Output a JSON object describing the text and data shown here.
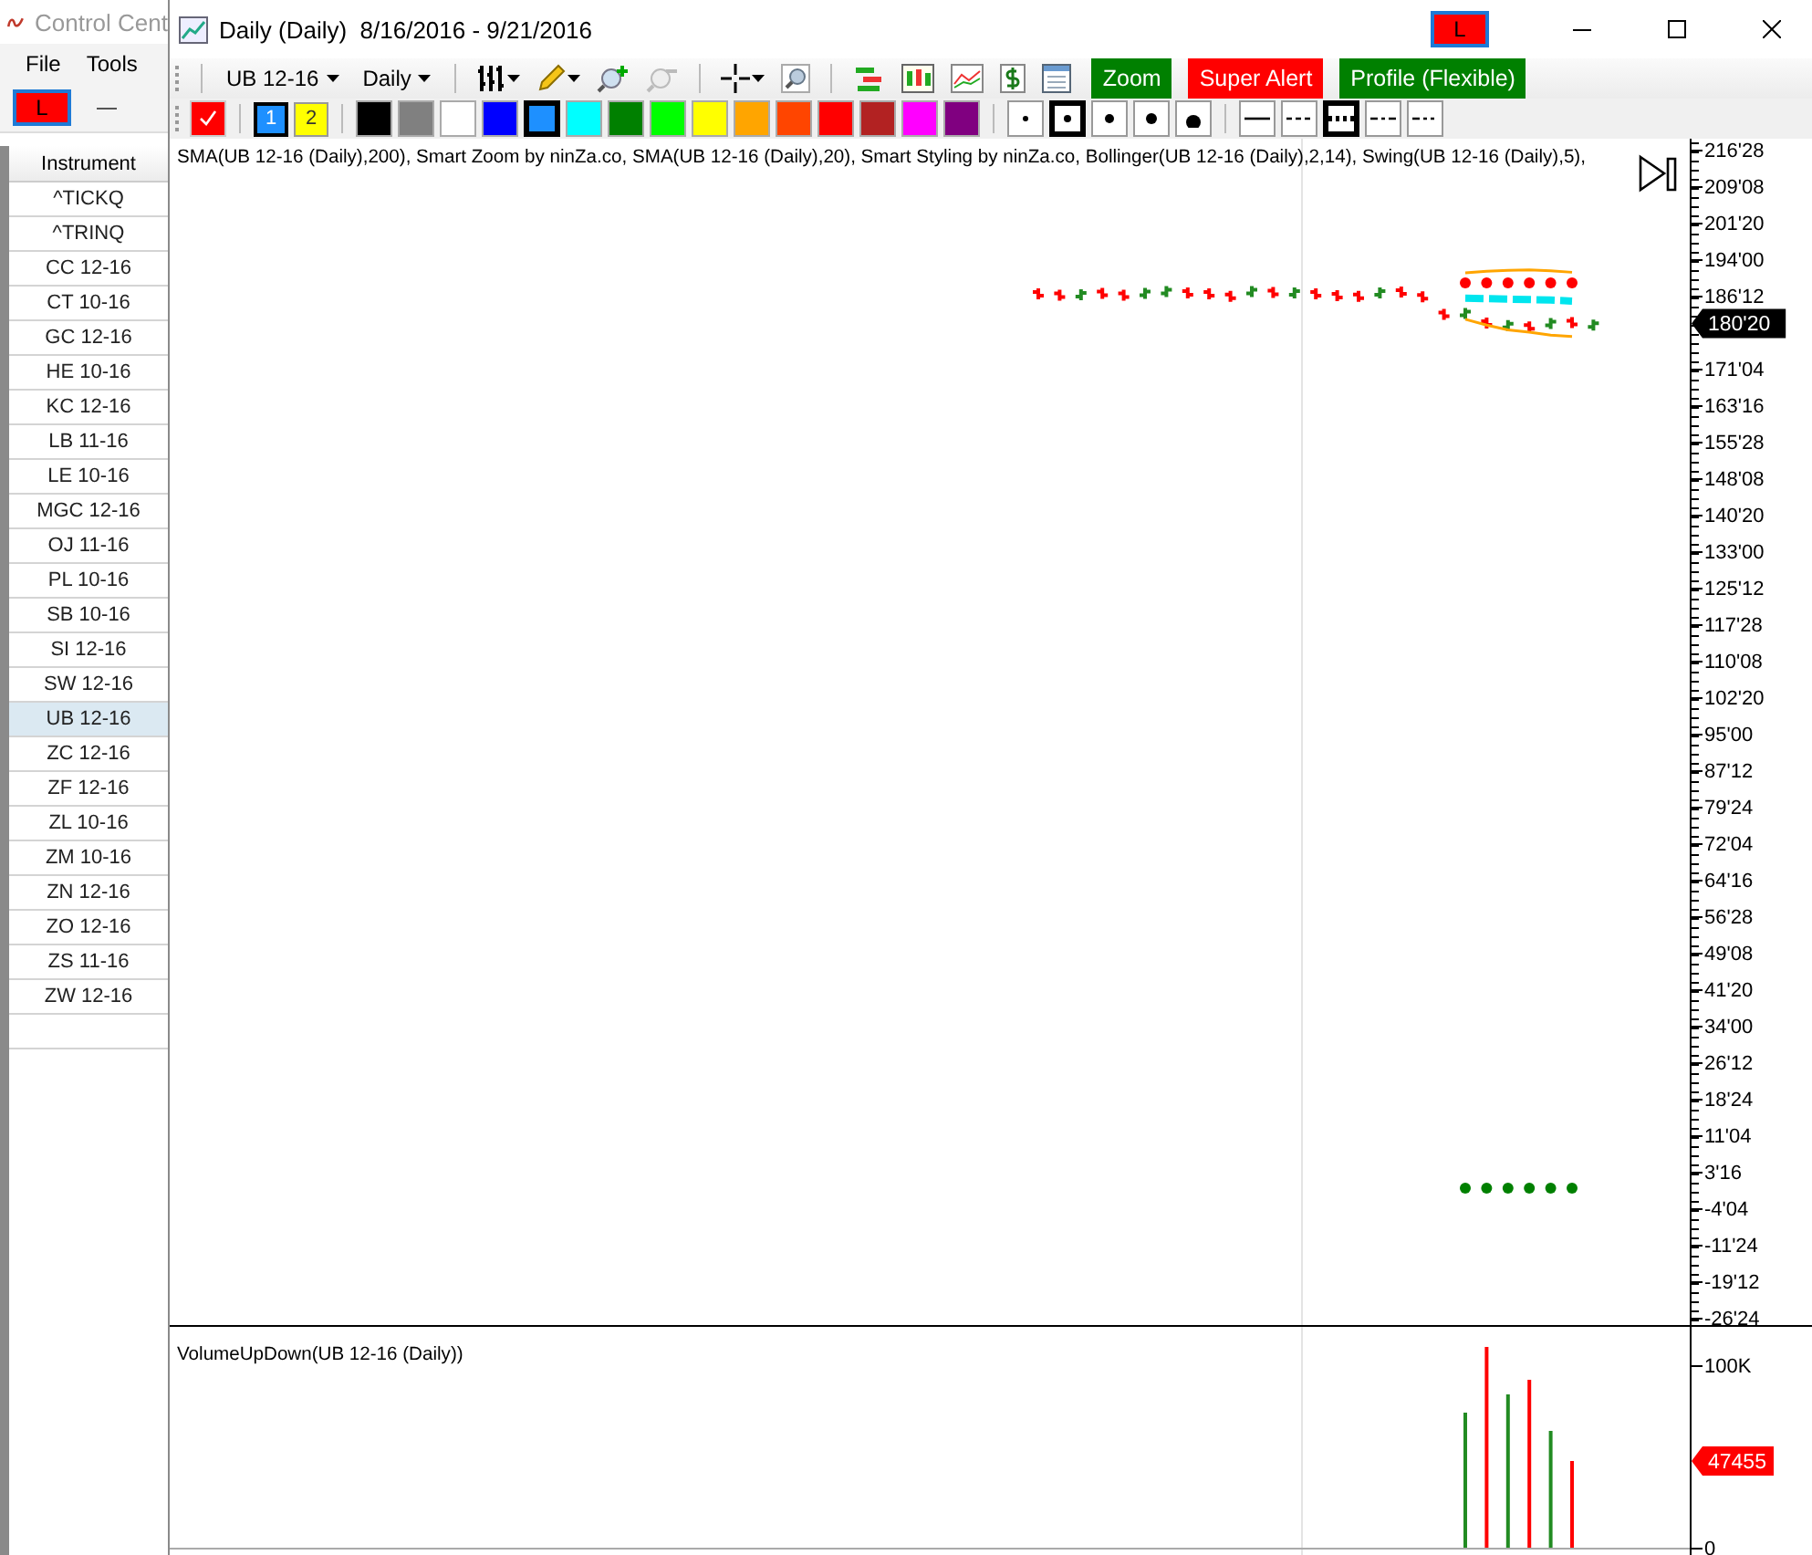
{
  "control_center": {
    "title": "Control Cent",
    "menu": [
      "File",
      "Tools"
    ],
    "link_button": "L",
    "instrument_list": {
      "column": "Instrument",
      "rows": [
        {
          "name": "^TICKQ",
          "selected": false
        },
        {
          "name": "^TRINQ",
          "selected": false
        },
        {
          "name": "CC 12-16",
          "selected": false
        },
        {
          "name": "CT 10-16",
          "selected": false
        },
        {
          "name": "GC 12-16",
          "selected": false
        },
        {
          "name": "HE 10-16",
          "selected": false
        },
        {
          "name": "KC 12-16",
          "selected": false
        },
        {
          "name": "LB 11-16",
          "selected": false
        },
        {
          "name": "LE 10-16",
          "selected": false
        },
        {
          "name": "MGC 12-16",
          "selected": false
        },
        {
          "name": "OJ 11-16",
          "selected": false
        },
        {
          "name": "PL 10-16",
          "selected": false
        },
        {
          "name": "SB 10-16",
          "selected": false
        },
        {
          "name": "SI 12-16",
          "selected": false
        },
        {
          "name": "SW 12-16",
          "selected": false
        },
        {
          "name": "UB 12-16",
          "selected": true
        },
        {
          "name": "ZC 12-16",
          "selected": false
        },
        {
          "name": "ZF 12-16",
          "selected": false
        },
        {
          "name": "ZL 10-16",
          "selected": false
        },
        {
          "name": "ZM 10-16",
          "selected": false
        },
        {
          "name": "ZN 12-16",
          "selected": false
        },
        {
          "name": "ZO 12-16",
          "selected": false
        },
        {
          "name": "ZS 11-16",
          "selected": false
        },
        {
          "name": "ZW 12-16",
          "selected": false
        }
      ]
    }
  },
  "chart_window": {
    "title": "Daily (Daily)  8/16/2016 - 9/21/2016",
    "link_button": "L",
    "toolbar": {
      "instrument": "UB 12-16",
      "interval": "Daily",
      "buttons": [
        {
          "label": "Zoom",
          "color": "#008000"
        },
        {
          "label": "Super Alert",
          "color": "#ff0000"
        },
        {
          "label": "Profile (Flexible)",
          "color": "#008000"
        }
      ]
    },
    "drawing_toolbar": {
      "presets": [
        {
          "label": "1",
          "color": "#1e90ff",
          "selected": true
        },
        {
          "label": "2",
          "color": "#ffff00",
          "selected": false
        }
      ],
      "colors": [
        {
          "color": "#000000",
          "selected": false
        },
        {
          "color": "#808080",
          "selected": false
        },
        {
          "color": "#ffffff",
          "selected": false
        },
        {
          "color": "#0000ff",
          "selected": false
        },
        {
          "color": "#1e90ff",
          "selected": true
        },
        {
          "color": "#00ffff",
          "selected": false
        },
        {
          "color": "#008000",
          "selected": false
        },
        {
          "color": "#00ff00",
          "selected": false
        },
        {
          "color": "#ffff00",
          "selected": false
        },
        {
          "color": "#ffa500",
          "selected": false
        },
        {
          "color": "#ff4500",
          "selected": false
        },
        {
          "color": "#ff0000",
          "selected": false
        },
        {
          "color": "#b22222",
          "selected": false
        },
        {
          "color": "#ff00ff",
          "selected": false
        },
        {
          "color": "#800080",
          "selected": false
        }
      ],
      "dot_sizes": [
        {
          "selected": false
        },
        {
          "selected": true
        },
        {
          "selected": false
        },
        {
          "selected": false
        },
        {
          "selected": false
        }
      ],
      "line_styles": [
        {
          "kind": "solid",
          "selected": false
        },
        {
          "kind": "dash",
          "selected": false
        },
        {
          "kind": "dot",
          "selected": true
        },
        {
          "kind": "dashdot",
          "selected": false
        },
        {
          "kind": "dashdotdot",
          "selected": false
        }
      ]
    },
    "price_panel": {
      "legend": "SMA(UB 12-16 (Daily),200), Smart Zoom by ninZa.co, SMA(UB 12-16 (Daily),20), Smart Styling by ninZa.co, Bollinger(UB 12-16 (Daily),2,14), Swing(UB 12-16 (Daily),5),",
      "axis_labels": [
        "216'28",
        "209'08",
        "201'20",
        "194'00",
        "186'12",
        "171'04",
        "163'16",
        "155'28",
        "148'08",
        "140'20",
        "133'00",
        "125'12",
        "117'28",
        "110'08",
        "102'20",
        "95'00",
        "87'12",
        "79'24",
        "72'04",
        "64'16",
        "56'28",
        "49'08",
        "41'20",
        "34'00",
        "26'12",
        "18'24",
        "11'04",
        "3'16",
        "-4'04",
        "-11'24",
        "-19'12",
        "-26'24"
      ],
      "last_price": "180'20"
    },
    "volume_panel": {
      "legend": "VolumeUpDown(UB 12-16 (Daily))",
      "axis_labels": [
        "100K",
        "0"
      ],
      "last_value": "47455"
    }
  }
}
